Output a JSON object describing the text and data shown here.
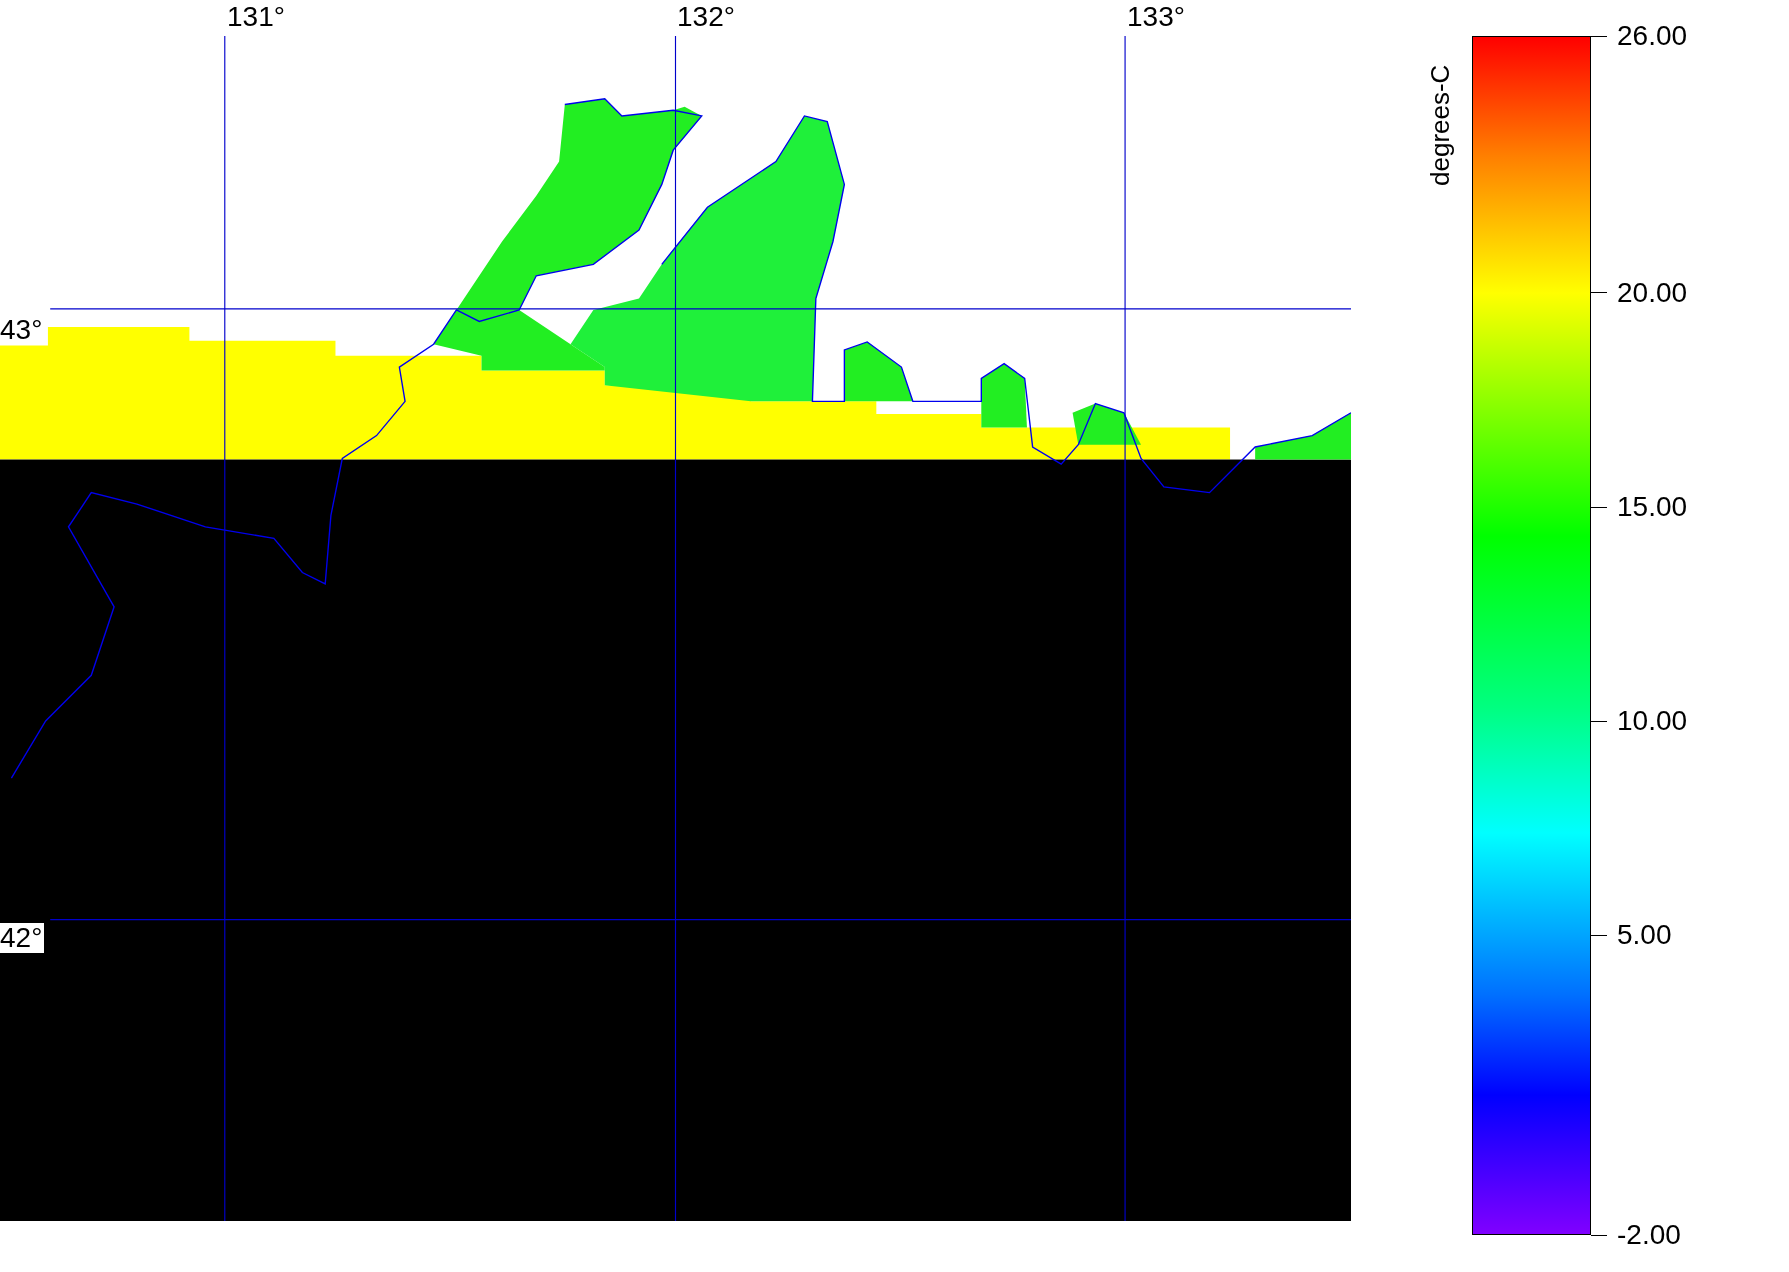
{
  "map": {
    "lon_labels": [
      "131°",
      "132°",
      "133°"
    ],
    "lat_labels": [
      "43°",
      "42°"
    ]
  },
  "colorbar": {
    "units": "degrees-C",
    "ticks": [
      "26.00",
      "20.00",
      "15.00",
      "10.00",
      "5.00",
      "-2.00"
    ]
  }
}
